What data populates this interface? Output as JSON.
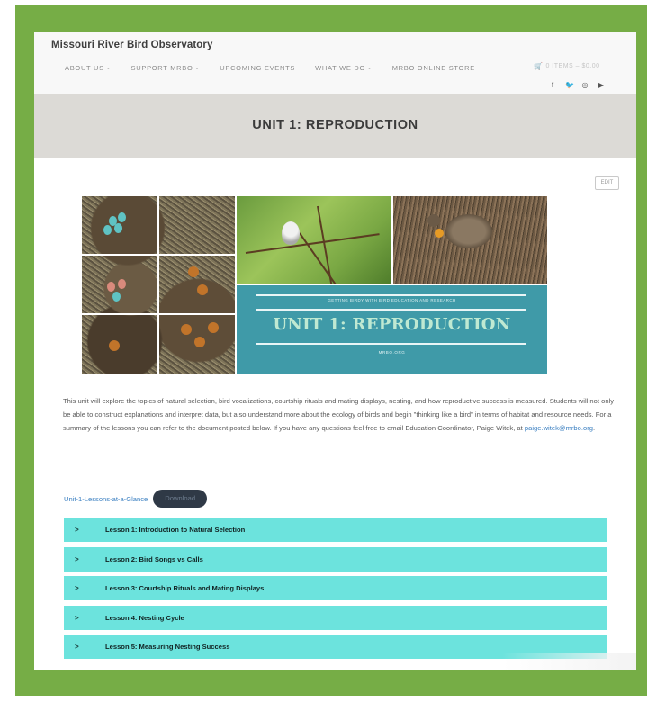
{
  "site": {
    "title": "Missouri River Bird Observatory"
  },
  "nav": {
    "items": [
      {
        "label": "About Us",
        "has_dropdown": true
      },
      {
        "label": "Support MRBO",
        "has_dropdown": true
      },
      {
        "label": "Upcoming Events",
        "has_dropdown": false
      },
      {
        "label": "What We Do",
        "has_dropdown": true
      },
      {
        "label": "MRBO Online Store",
        "has_dropdown": false
      }
    ],
    "dropdown_glyph": "⌄",
    "cart": {
      "icon": "cart-icon",
      "glyph": "🛒",
      "text": "0 ITEMS – $0.00"
    }
  },
  "social": [
    {
      "name": "facebook-icon",
      "glyph": "f"
    },
    {
      "name": "twitter-icon",
      "glyph": "🐦"
    },
    {
      "name": "instagram-icon",
      "glyph": "◎"
    },
    {
      "name": "youtube-icon",
      "glyph": "▶"
    }
  ],
  "banner": {
    "title": "UNIT 1: REPRODUCTION"
  },
  "edit_label": "EDIT",
  "hero": {
    "subtitle": "Getting Birdy with Bird Education and Research",
    "title": "UNIT 1: REPRODUCTION",
    "footer": "MRBO.ORG"
  },
  "intro": {
    "text": "This unit will explore the topics of natural selection, bird vocalizations, courtship rituals and mating displays, nesting, and how reproductive success is measured. Students will not only be able to construct explanations and interpret data, but also understand more about the ecology of birds and begin \"thinking like a bird\" in terms of habitat and resource needs. For a summary of the lessons you can refer to the document posted below. If you have any questions feel free to email Education Coordinator, Paige Witek, at ",
    "email": "paige.witek@mrbo.org",
    "end": "."
  },
  "lessons_glance": {
    "link": "Unit-1-Lessons-at-a-Glance",
    "download": "Download"
  },
  "lessons": [
    {
      "label": "Lesson 1: Introduction to Natural Selection"
    },
    {
      "label": "Lesson 2: Bird Songs vs Calls"
    },
    {
      "label": "Lesson 3: Courtship Rituals and Mating Displays"
    },
    {
      "label": "Lesson 4: Nesting Cycle"
    },
    {
      "label": "Lesson 5: Measuring Nesting Success"
    }
  ],
  "caret_glyph": ">",
  "colors": {
    "frame": "#76ad46",
    "banner": "#dcdad6",
    "accordion": "#6ce3dd",
    "hero_teal": "#3f9aa8",
    "link": "#3a7fc1",
    "download_button": "#2f3946"
  }
}
